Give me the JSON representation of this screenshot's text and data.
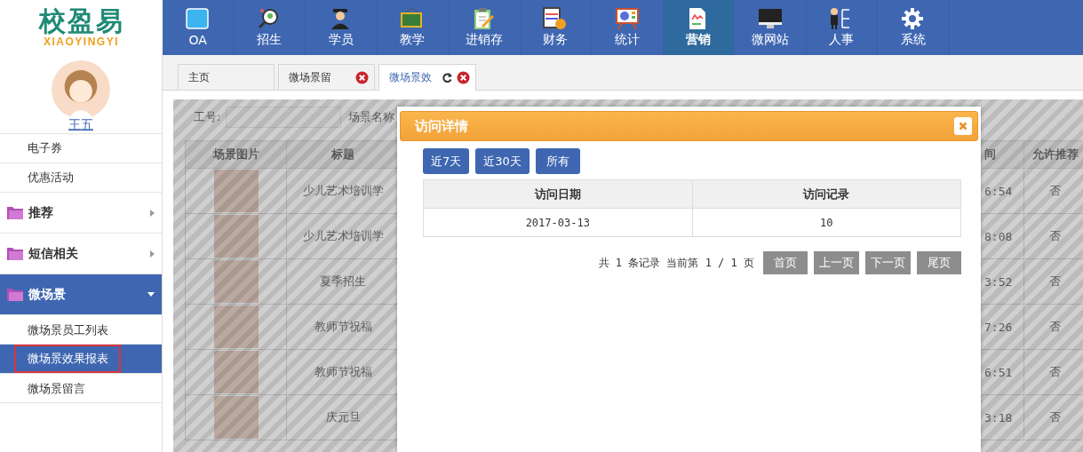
{
  "logo": {
    "name": "校盈易",
    "subtitle": "XIAOYINGYI"
  },
  "nav": [
    {
      "label": "OA",
      "selected": false
    },
    {
      "label": "招生",
      "selected": false
    },
    {
      "label": "学员",
      "selected": false
    },
    {
      "label": "教学",
      "selected": false
    },
    {
      "label": "进销存",
      "selected": false
    },
    {
      "label": "财务",
      "selected": false
    },
    {
      "label": "统计",
      "selected": false
    },
    {
      "label": "营销",
      "selected": true
    },
    {
      "label": "微网站",
      "selected": false
    },
    {
      "label": "人事",
      "selected": false
    },
    {
      "label": "系统",
      "selected": false
    }
  ],
  "user": {
    "name": "王五"
  },
  "sidebar": {
    "items": [
      {
        "label": "电子券",
        "kind": "link",
        "selected": false
      },
      {
        "label": "优惠活动",
        "kind": "link",
        "selected": false
      },
      {
        "label": "推荐",
        "kind": "folder",
        "expanded": false
      },
      {
        "label": "短信相关",
        "kind": "folder",
        "expanded": false
      },
      {
        "label": "微场景",
        "kind": "folder",
        "expanded": true,
        "children": [
          {
            "label": "微场景员工列表",
            "selected": false
          },
          {
            "label": "微场景效果报表",
            "selected": true
          },
          {
            "label": "微场景留言",
            "selected": false
          }
        ]
      }
    ]
  },
  "tabs": [
    {
      "label": "主页",
      "kind": "home",
      "selected": false
    },
    {
      "label": "微场景留",
      "kind": "closable",
      "selected": false
    },
    {
      "label": "微场景效",
      "kind": "closable",
      "selected": true
    }
  ],
  "filter": {
    "label": "工号:",
    "label_2": "场景名称"
  },
  "table": {
    "columns": [
      "场景图片",
      "标题",
      "间",
      "允许推荐"
    ],
    "rows": [
      [
        "",
        "少儿艺术培训学",
        "6:54",
        "否"
      ],
      [
        "",
        "少儿艺术培训学",
        "8:08",
        "否"
      ],
      [
        "",
        "夏季招生",
        "3:52",
        "否"
      ],
      [
        "",
        "教师节祝福",
        "7:26",
        "否"
      ],
      [
        "",
        "教师节祝福",
        "6:51",
        "否"
      ],
      [
        "",
        "庆元旦",
        "3:18",
        "否"
      ]
    ]
  },
  "dialog": {
    "title": "访问详情",
    "ranges": [
      "近7天",
      "近30天",
      "所有"
    ],
    "columns": [
      "访问日期",
      "访问记录"
    ],
    "rows": [
      [
        "2017-03-13",
        "10"
      ]
    ],
    "pagination": {
      "summary": "共 1 条记录 当前第 1 / 1 页",
      "buttons": [
        "首页",
        "上一页",
        "下一页",
        "尾页"
      ]
    }
  }
}
